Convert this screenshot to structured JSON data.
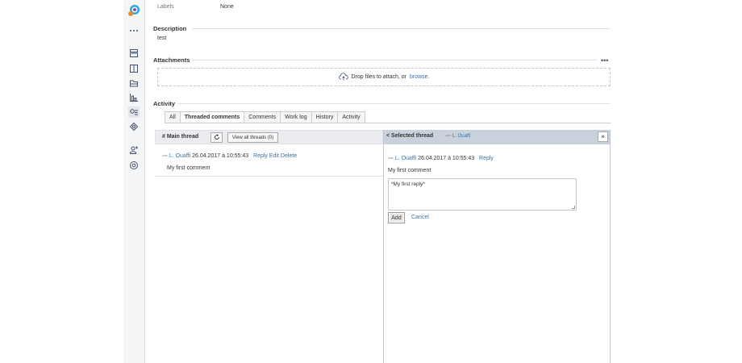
{
  "sidebar": {
    "icons": [
      "app-logo-icon",
      "more-icon",
      "board-icon",
      "columns-icon",
      "folder-icon",
      "chart-icon",
      "search-people-icon",
      "settings-flower-icon",
      "add-user-icon",
      "gear-icon"
    ]
  },
  "details": {
    "labels_label": "Labels",
    "labels_value": "None"
  },
  "description": {
    "title": "Description",
    "text": "test"
  },
  "attachments": {
    "title": "Attachments",
    "more": "•••",
    "drop_text": "Drop files to attach, or",
    "browse": "browse."
  },
  "activity": {
    "title": "Activity",
    "tabs": [
      "All",
      "Threaded comments",
      "Comments",
      "Work log",
      "History",
      "Activity"
    ],
    "active_tab": "Threaded comments"
  },
  "main_thread": {
    "title": "# Main thread",
    "view_all": "View all threads (0)",
    "author": "L. Ouaffi",
    "date": "26.04.2017 à 10:55:43",
    "reply": "Reply",
    "edit": "Edit",
    "delete": "Delete",
    "comment": "My first comment"
  },
  "selected_thread": {
    "title": "< Selected thread",
    "head_author": "L. Ouaffi",
    "close": "×",
    "author": "L. Ouaffi",
    "date": "26.04.2017 à 10:55:43",
    "reply": "Reply",
    "comment": "My first comment",
    "reply_text": "*My first reply*",
    "add": "Add",
    "cancel": "Cancel"
  },
  "colors": {
    "link": "#3572b0",
    "selected_header": "#c9d1dc",
    "main_header": "#ebecf0"
  }
}
